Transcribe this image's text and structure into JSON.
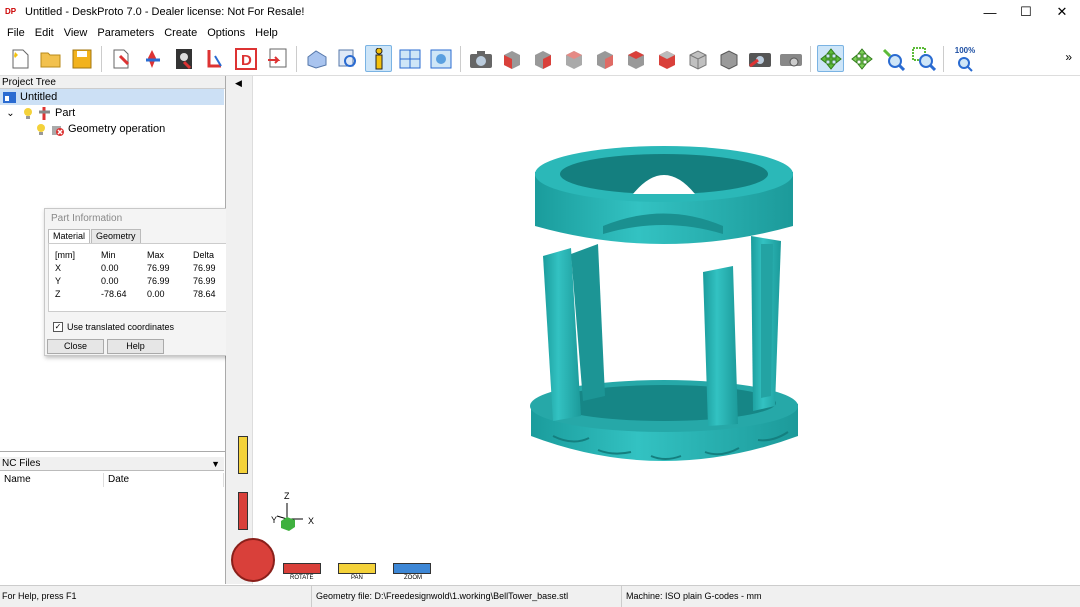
{
  "titlebar": {
    "app_icon_text": "DP",
    "title": "Untitled - DeskProto 7.0 - Dealer license: Not For Resale!",
    "minimize": "—",
    "maximize": "☐",
    "close": "✕"
  },
  "menu": [
    "File",
    "Edit",
    "View",
    "Parameters",
    "Create",
    "Options",
    "Help"
  ],
  "toolbar": {
    "zoom_pct": "100%",
    "more": "»",
    "icons": [
      "new-file",
      "open-folder",
      "save",
      "part-wizard",
      "geometry",
      "photo",
      "stencil",
      "drawing",
      "export",
      "eraser",
      "preview",
      "info",
      "split-view",
      "screen",
      "camera",
      "view-front",
      "view-back",
      "view-left",
      "view-right",
      "view-top",
      "view-bottom",
      "view-iso",
      "view-solid",
      "screenshot",
      "settings-print",
      "rotate",
      "pan",
      "zoom-in",
      "zoom-window",
      "zoom-100"
    ],
    "colors": {
      "accent_active": "#cde5f8",
      "cube_red": "#d9403a",
      "cube_gray": "#9a9a9a",
      "teal": "#2dbfbf",
      "green": "#5dbb3a",
      "yellow": "#f4c20d"
    }
  },
  "project_tree": {
    "header": "Project Tree",
    "root": "Untitled",
    "part": "Part",
    "geometry_operation": "Geometry operation"
  },
  "part_info": {
    "title": "Part Information",
    "tabs": [
      "Material",
      "Geometry"
    ],
    "columns": [
      "[mm]",
      "Min",
      "Max",
      "Delta"
    ],
    "rows": [
      [
        "X",
        "0.00",
        "76.99",
        "76.99"
      ],
      [
        "Y",
        "0.00",
        "76.99",
        "76.99"
      ],
      [
        "Z",
        "-78.64",
        "0.00",
        "78.64"
      ]
    ],
    "checkbox_label": "Use translated coordinates",
    "checkbox_checked": true,
    "close_label": "Close",
    "help_label": "Help"
  },
  "nc_files": {
    "header": "NC Files",
    "columns": [
      "Name",
      "Date"
    ]
  },
  "viewport": {
    "axes": {
      "x": "X",
      "y": "Y",
      "z": "Z"
    },
    "controls": [
      "ROTATE",
      "PAN",
      "ZOOM"
    ],
    "model_color": "#2ab3b3"
  },
  "statusbar": {
    "help": "For Help, press F1",
    "geometry_file": "Geometry file: D:\\Freedesignwold\\1.working\\BellTower_base.stl",
    "machine": "Machine: ISO plain G-codes - mm"
  }
}
